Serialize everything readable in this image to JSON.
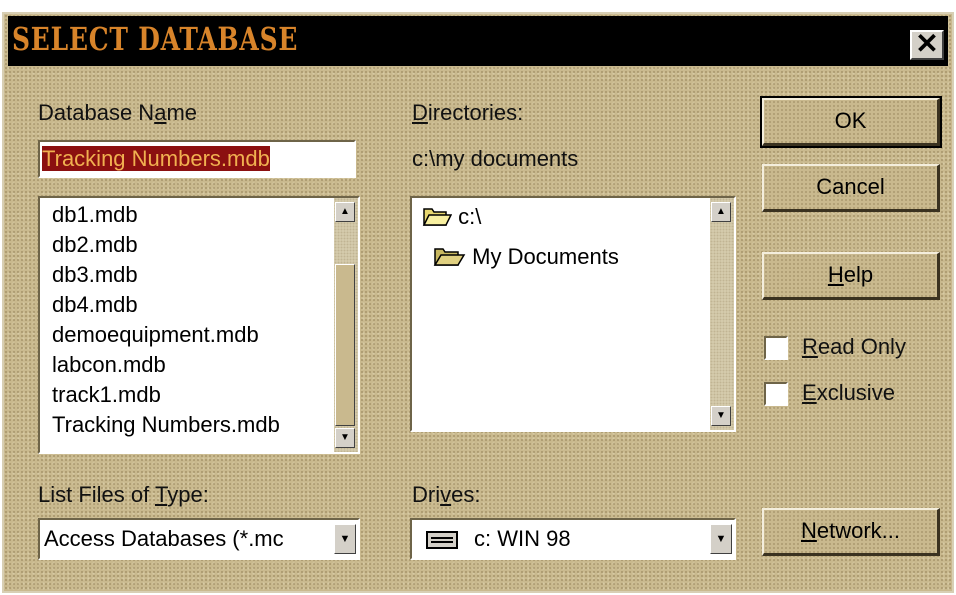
{
  "title": "SELECT DATABASE",
  "close_label": "✕",
  "database_name": {
    "label_pre": "Database N",
    "label_key": "a",
    "label_post": "me",
    "value": "Tracking Numbers.mdb"
  },
  "files": [
    "db1.mdb",
    "db2.mdb",
    "db3.mdb",
    "db4.mdb",
    "demoequipment.mdb",
    "labcon.mdb",
    "track1.mdb",
    "Tracking Numbers.mdb"
  ],
  "directories": {
    "label_key": "D",
    "label_post": "irectories:",
    "current_path": "c:\\my documents",
    "items": [
      "c:\\",
      "My Documents"
    ]
  },
  "buttons": {
    "ok": "OK",
    "cancel": "Cancel",
    "help_key": "H",
    "help_post": "elp",
    "network_key": "N",
    "network_post": "etwork..."
  },
  "checkboxes": {
    "read_only_key": "R",
    "read_only_post": "ead Only",
    "read_only_checked": false,
    "exclusive_key": "E",
    "exclusive_post": "xclusive",
    "exclusive_checked": false
  },
  "file_type": {
    "label_pre": "List Files of ",
    "label_key": "T",
    "label_post": "ype:",
    "value": "Access Databases (*.mc"
  },
  "drives": {
    "label_pre": "Dri",
    "label_key": "v",
    "label_post": "es:",
    "value": "c: WIN 98"
  },
  "scroll_arrows": {
    "up": "▲",
    "down": "▼"
  },
  "colors": {
    "title_text": "#d8842a",
    "dialog_bg": "#c9b98e",
    "selection_bg": "#8b1010",
    "selection_text": "#f0b050"
  }
}
